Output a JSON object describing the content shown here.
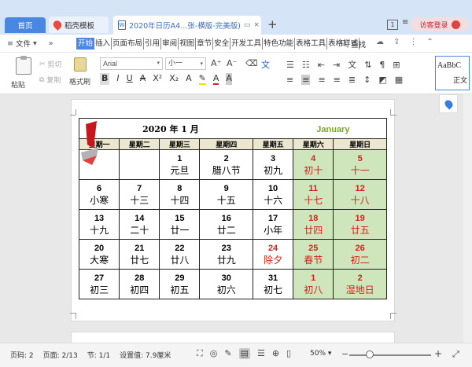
{
  "tabs": {
    "home": "首页",
    "daoke": "稻壳模板",
    "doc": "2020年日历A4...张-横版-完美版)",
    "doc_icon": "W",
    "count": "1",
    "login": "访客登录"
  },
  "menu": {
    "file": "文件",
    "items": [
      "开始",
      "插入",
      "页面布局",
      "引用",
      "审阅",
      "视图",
      "章节",
      "安全",
      "开发工具",
      "特色功能",
      "表格工具",
      "表格样式"
    ],
    "search": "查找"
  },
  "ribbon": {
    "paste": "粘贴",
    "cut": "剪切",
    "copy": "复制",
    "format_painter": "格式刷",
    "font": "Arial",
    "size": "小一",
    "style_sample": "AaBbC",
    "style_name": "正文"
  },
  "calendar": {
    "title": "2020 年 1 月",
    "month_en": "January",
    "headers": [
      "星期一",
      "星期二",
      "星期三",
      "星期四",
      "星期五",
      "星期六",
      "星期日"
    ],
    "rows": [
      [
        {
          "n": "",
          "l": ""
        },
        {
          "n": "",
          "l": ""
        },
        {
          "n": "1",
          "l": "元旦"
        },
        {
          "n": "2",
          "l": "腊八节"
        },
        {
          "n": "3",
          "l": "初九"
        },
        {
          "n": "4",
          "l": "初十"
        },
        {
          "n": "5",
          "l": "十一"
        }
      ],
      [
        {
          "n": "6",
          "l": "小寒"
        },
        {
          "n": "7",
          "l": "十三"
        },
        {
          "n": "8",
          "l": "十四"
        },
        {
          "n": "9",
          "l": "十五"
        },
        {
          "n": "10",
          "l": "十六"
        },
        {
          "n": "11",
          "l": "十七"
        },
        {
          "n": "12",
          "l": "十八"
        }
      ],
      [
        {
          "n": "13",
          "l": "十九"
        },
        {
          "n": "14",
          "l": "二十"
        },
        {
          "n": "15",
          "l": "廿一"
        },
        {
          "n": "16",
          "l": "廿二"
        },
        {
          "n": "17",
          "l": "小年"
        },
        {
          "n": "18",
          "l": "廿四"
        },
        {
          "n": "19",
          "l": "廿五"
        }
      ],
      [
        {
          "n": "20",
          "l": "大寒"
        },
        {
          "n": "21",
          "l": "廿七"
        },
        {
          "n": "22",
          "l": "廿八"
        },
        {
          "n": "23",
          "l": "廿九"
        },
        {
          "n": "24",
          "l": "除夕"
        },
        {
          "n": "25",
          "l": "春节"
        },
        {
          "n": "26",
          "l": "初二"
        }
      ],
      [
        {
          "n": "27",
          "l": "初三"
        },
        {
          "n": "28",
          "l": "初四"
        },
        {
          "n": "29",
          "l": "初五"
        },
        {
          "n": "30",
          "l": "初六"
        },
        {
          "n": "31",
          "l": "初七"
        },
        {
          "n": "1",
          "l": "初八"
        },
        {
          "n": "2",
          "l": "湿地日"
        }
      ]
    ],
    "red_weekday": [
      {
        "row": 3,
        "col": 4
      }
    ],
    "colors": {
      "weekend_bg": "#cfe6bd",
      "header_bg": "#eae6cf",
      "red": "#d8201c",
      "month_en": "#7ba62a"
    }
  },
  "status": {
    "page_num": "页码: 2",
    "page": "页面: 2/13",
    "section": "节: 1/1",
    "setting": "设置值: 7.9厘米",
    "zoom": "50%",
    "zoom_level": 0.25
  },
  "icons": [
    "file-icon",
    "undo-icon",
    "redo-icon",
    "search-icon",
    "cloud-icon",
    "share-icon",
    "more-icon",
    "location-pin-icon"
  ]
}
